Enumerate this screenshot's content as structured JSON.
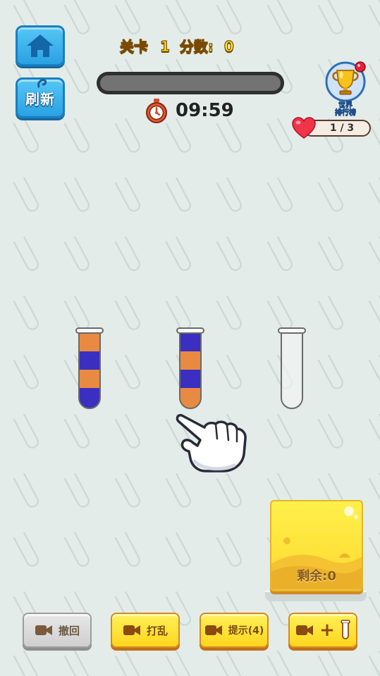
{
  "header": {
    "level_label": "关卡",
    "level_value": "1",
    "score_label": "分数:",
    "score_value": "0"
  },
  "buttons": {
    "home_icon": "home-icon",
    "refresh_label": "刷新"
  },
  "timer": {
    "icon": "stopwatch-icon",
    "value": "09:59"
  },
  "progress": {
    "fraction": 0.0
  },
  "leaderboard": {
    "icon": "trophy-icon",
    "label_line1": "世界",
    "label_line2": "排行榜"
  },
  "lives": {
    "icon": "heart-icon",
    "value": "1 / 3"
  },
  "tubes": [
    {
      "layers": [
        "orange",
        "blue",
        "orange",
        "blue"
      ]
    },
    {
      "layers": [
        "blue",
        "orange",
        "blue",
        "orange"
      ]
    },
    {
      "layers": []
    }
  ],
  "colors": {
    "orange": "#e98a42",
    "blue": "#3a2fc0",
    "tube_outline": "#666666",
    "brand_blue": "#2aa1e3",
    "yellow": "#ffe23a"
  },
  "stock": {
    "label": "剩余:0"
  },
  "bottom_bar": {
    "undo_label": "撤回",
    "shuffle_label": "打乱",
    "hint_label": "提示(4)",
    "add_tube_label": "+",
    "video_icon": "video-camera-icon"
  }
}
